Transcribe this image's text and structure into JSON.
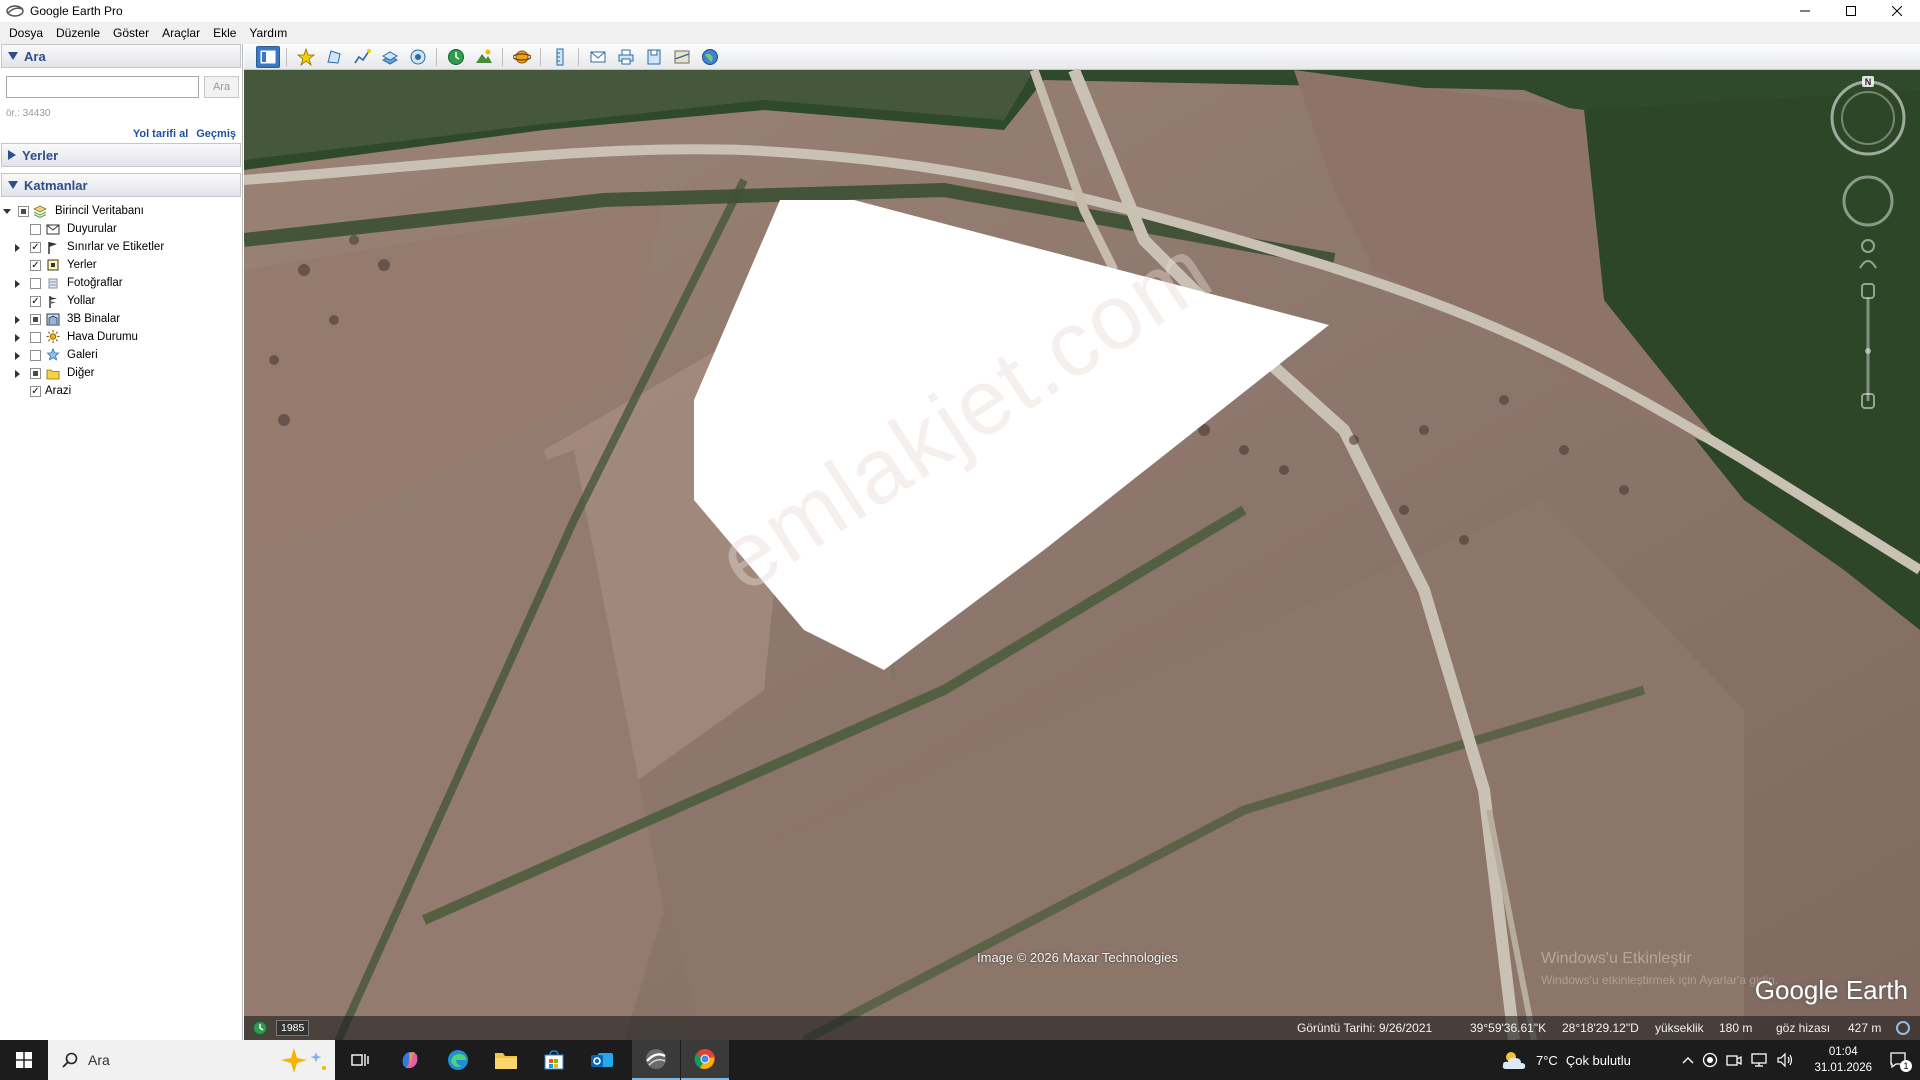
{
  "window": {
    "title": "Google Earth Pro"
  },
  "menu": [
    {
      "label": "Dosya"
    },
    {
      "label": "Düzenle"
    },
    {
      "label": "Göster"
    },
    {
      "label": "Araçlar"
    },
    {
      "label": "Ekle"
    },
    {
      "label": "Yardım"
    }
  ],
  "search_panel": {
    "header": "Ara",
    "input_value": "",
    "button_label": "Ara",
    "hint": "ör.: 34430",
    "directions_link": "Yol tarifi al",
    "history_link": "Geçmiş"
  },
  "places_panel": {
    "header": "Yerler"
  },
  "layers_panel": {
    "header": "Katmanlar",
    "root": {
      "label": "Birincil Veritabanı",
      "state": "partial",
      "expanded": true
    },
    "items": [
      {
        "label": "Duyurular",
        "state": "unchecked",
        "expandable": false,
        "icon": "envelope-icon"
      },
      {
        "label": "Sınırlar ve Etiketler",
        "state": "checked",
        "expandable": true,
        "icon": "flag-icon"
      },
      {
        "label": "Yerler",
        "state": "checked",
        "expandable": false,
        "icon": "places-square-icon"
      },
      {
        "label": "Fotoğraflar",
        "state": "unchecked",
        "expandable": true,
        "icon": "photo-icon"
      },
      {
        "label": "Yollar",
        "state": "checked",
        "expandable": false,
        "icon": "road-sign-icon"
      },
      {
        "label": "3B Binalar",
        "state": "partial",
        "expandable": true,
        "icon": "building-icon"
      },
      {
        "label": "Hava Durumu",
        "state": "unchecked",
        "expandable": true,
        "icon": "sun-icon"
      },
      {
        "label": "Galeri",
        "state": "unchecked",
        "expandable": true,
        "icon": "star-icon"
      },
      {
        "label": "Diğer",
        "state": "partial",
        "expandable": true,
        "icon": "folder-icon"
      }
    ],
    "terrain": {
      "label": "Arazi",
      "state": "checked"
    }
  },
  "toolbar": {
    "buttons": [
      "sidebar-toggle-icon",
      "placemark-icon",
      "polygon-icon",
      "path-icon",
      "image-overlay-icon",
      "record-tour-icon",
      "historical-imagery-icon",
      "sunlight-icon",
      "planets-icon",
      "ruler-icon",
      "email-icon",
      "print-icon",
      "save-image-icon",
      "maps-icon",
      "earth-icon"
    ]
  },
  "map": {
    "watermark": "emlakjet.com",
    "imagery_credit": "Image © 2026 Maxar Technologies",
    "logo": "Google Earth",
    "activate_title": "Windows'u Etkinleştir",
    "activate_sub": "Windows'u etkinleştirmek için Ayarlar'a gidin.",
    "compass_letter": "N"
  },
  "status_bar": {
    "history_year": "1985",
    "imagery_date": "Görüntü Tarihi: 9/26/2021",
    "latitude": "39°59'36.61\"K",
    "longitude": "28°18'29.12\"D",
    "elevation_label": "yükseklik",
    "elevation_value": "180 m",
    "eye_alt_label": "göz hizası",
    "eye_alt_value": "427 m"
  },
  "taskbar": {
    "search_label": "Ara",
    "weather_temp": "7°C",
    "weather_desc": "Çok bulutlu",
    "time": "01:04",
    "date": "31.01.2026",
    "notification_count": "1"
  },
  "colors": {
    "accent_blue": "#2d4f8a",
    "link_blue": "#1f4f9d",
    "taskbar_bg": "#1c1c1c",
    "chrome_red": "#db4437"
  }
}
